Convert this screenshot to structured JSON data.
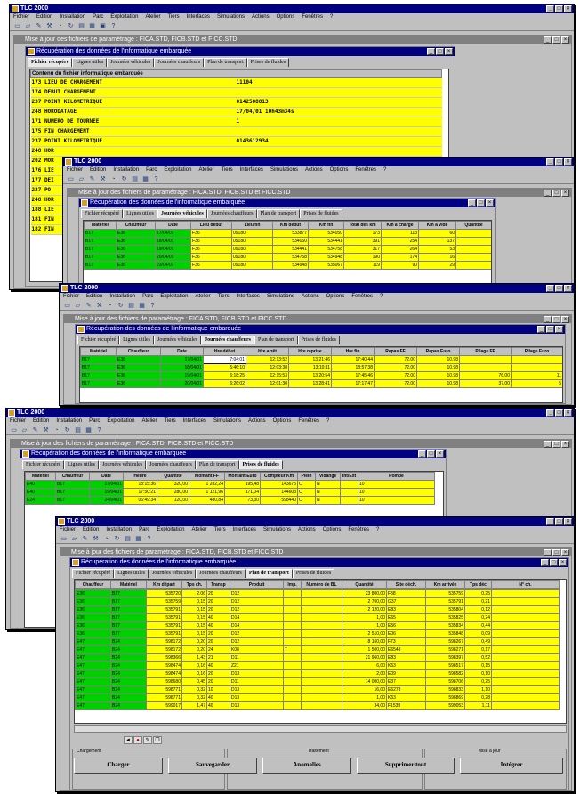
{
  "app": {
    "title": "TLC 2000",
    "menu": [
      "Fichier",
      "Edition",
      "Installation",
      "Parc",
      "Exploitation",
      "Atelier",
      "Tiers",
      "Interfaces",
      "Simulations",
      "Actions",
      "Options",
      "Fenêtres",
      "?"
    ],
    "tool_icons": [
      "new-icon",
      "open-icon",
      "edit-icon",
      "tools-icon",
      "chart-icon",
      "refresh-icon",
      "print-icon",
      "preview-icon",
      "calculator-icon",
      "window-icon",
      "help-icon"
    ],
    "window_buttons": [
      "_",
      "□",
      "×"
    ]
  },
  "sub_title_1": "Mise à jour des fichiers de paramétrage : FICA.STD, FICB.STD et FICC.STD",
  "sub_title_2": "Mise à jour des fichiers de paramétrage : FICA.STD, FICB.STD et FICC.STD",
  "inner_title": "Récupération des données de l'informatique embarquée",
  "tabs": [
    "Fichier récupéré",
    "Lignes utiles",
    "Journées véhicules",
    "Journées chauffeurs",
    "Plan de transport",
    "Prises de fluides"
  ],
  "win1": {
    "grid_header": "Contenu du fichier informatique embarquée",
    "lines": [
      [
        "173 LIEU DE CHARGEMENT",
        "11104"
      ],
      [
        "174 DEBUT CHARGEMENT",
        ""
      ],
      [
        "237 POINT KILOMETRIQUE",
        "0142588813"
      ],
      [
        "248 HORODATAGE",
        "17/04/01     10h43m34s"
      ],
      [
        "171 NUMERO DE TOURNEE",
        "1"
      ],
      [
        "175 FIN CHARGEMENT",
        ""
      ],
      [
        "237 POINT KILOMETRIQUE",
        "0143612934"
      ],
      [
        "248 HOR",
        ""
      ],
      [
        "202 MOR",
        ""
      ],
      [
        "176 LIE",
        ""
      ],
      [
        "177 DEI",
        ""
      ],
      [
        "237 PO",
        ""
      ],
      [
        "248 HOR",
        ""
      ],
      [
        "188 LIE",
        ""
      ],
      [
        "181 FIN",
        ""
      ],
      [
        "182 FIN",
        ""
      ]
    ],
    "footer_label": "Chargement"
  },
  "win2": {
    "headers": [
      "Matériel",
      "Chauffeur",
      "Date",
      "Lieu début",
      "Lieu fin",
      "Km début",
      "Km fin",
      "Total des km",
      "Km à charge",
      "Km à vide",
      "Quantité"
    ],
    "rows": [
      [
        "B17",
        "E36",
        "17/04/01",
        "F36",
        "09180",
        "533877",
        "534050",
        "173",
        "113",
        "60",
        ""
      ],
      [
        "B17",
        "E36",
        "18/04/01",
        "F36",
        "09180",
        "534050",
        "534441",
        "391",
        "254",
        "137",
        ""
      ],
      [
        "B17",
        "E36",
        "19/04/01",
        "F36",
        "09180",
        "534441",
        "534758",
        "317",
        "264",
        "53",
        ""
      ],
      [
        "B17",
        "E36",
        "20/04/01",
        "F36",
        "09180",
        "534758",
        "534948",
        "190",
        "174",
        "16",
        ""
      ],
      [
        "B17",
        "E36",
        "23/04/01",
        "F36",
        "09180",
        "534948",
        "535067",
        "119",
        "90",
        "29",
        ""
      ]
    ]
  },
  "win3": {
    "headers": [
      "Matériel",
      "Chauffeur",
      "Date",
      "Hre début",
      "Hre arrêt",
      "Hre reprise",
      "Hre fin",
      "Repas FF",
      "Repas Euro",
      "Pilage FF",
      "Pilage Euro"
    ],
    "rows": [
      [
        "B17",
        "E36",
        "17/04/01",
        "7:04:01",
        "12:13:52",
        "13:21:46",
        "17:40:44",
        "72,00",
        "10,98",
        "",
        ""
      ],
      [
        "B17",
        "E36",
        "18/04/01",
        "5:46:10",
        "12:03:38",
        "13:10:11",
        "18:57:38",
        "72,00",
        "10,98",
        "",
        ""
      ],
      [
        "B17",
        "E36",
        "19/04/01",
        "6:18:25",
        "12:15:53",
        "13:20:54",
        "17:45:46",
        "72,00",
        "10,98",
        "76,00",
        "11"
      ],
      [
        "B17",
        "E36",
        "20/04/01",
        "6:26:02",
        "12:01:30",
        "13:28:41",
        "17:17:47",
        "72,00",
        "10,98",
        "37,00",
        "5"
      ]
    ]
  },
  "win4": {
    "headers": [
      "Matériel",
      "Chauffeur",
      "Date",
      "Heure",
      "Quantité",
      "Montant FF",
      "Montant Euro",
      "Compteur Km",
      "Plein",
      "Vidange",
      "Int/Ext",
      "Pompe"
    ],
    "rows": [
      [
        "E40",
        "B17",
        "17/04/01",
        "18:15:36",
        "320,00",
        "1 282,24",
        "195,48",
        "143675",
        "O",
        "N",
        "I",
        "10"
      ],
      [
        "E40",
        "B17",
        "19/04/01",
        "17:50:21",
        "280,00",
        "1 121,96",
        "171,04",
        "144603",
        "O",
        "N",
        "I",
        "10"
      ],
      [
        "E24",
        "B17",
        "24/04/01",
        "06:49:34",
        "120,00",
        "480,84",
        "73,30",
        "598440",
        "O",
        "N",
        "I",
        "10"
      ]
    ]
  },
  "win5": {
    "headers": [
      "Chauffeur",
      "Matériel",
      "Km départ",
      "Tps ch.",
      "Transp",
      "Produit",
      "Imp.",
      "Numéro de BL",
      "Quantité",
      "Site déch.",
      "Km arrivée",
      "Tps déc",
      "N° ch."
    ],
    "rows": [
      [
        "E36",
        "B17",
        "535720",
        "2,06",
        "20",
        "D12",
        "",
        "",
        "23 800,00",
        "F38",
        "535759",
        "0,25",
        ""
      ],
      [
        "E36",
        "B17",
        "535759",
        "0,15",
        "20",
        "D12",
        "",
        "",
        "2 700,00",
        "G37",
        "535791",
        "0,21",
        ""
      ],
      [
        "E36",
        "B17",
        "535791",
        "0,15",
        "20",
        "D12",
        "",
        "",
        "2 120,00",
        "E83",
        "535804",
        "0,12",
        ""
      ],
      [
        "E36",
        "B17",
        "535791",
        "0,15",
        "40",
        "D14",
        "",
        "",
        "1,00",
        "E65",
        "535825",
        "0,24",
        ""
      ],
      [
        "E36",
        "B17",
        "535791",
        "0,15",
        "40",
        "D14",
        "",
        "",
        "1,00",
        "E56",
        "535834",
        "0,44",
        ""
      ],
      [
        "E36",
        "B17",
        "535791",
        "0,15",
        "20",
        "D12",
        "",
        "",
        "2 510,00",
        "E06",
        "535848",
        "0,09",
        ""
      ],
      [
        "E47",
        "B24",
        "598172",
        "0,20",
        "20",
        "D12",
        "",
        "",
        "8 160,00",
        "F73",
        "598267",
        "0,49",
        ""
      ],
      [
        "E47",
        "B24",
        "598172",
        "0,20",
        "24",
        "K08",
        "T",
        "",
        "1 500,00",
        "E6548",
        "598271",
        "0,17",
        ""
      ],
      [
        "E47",
        "B24",
        "598366",
        "1,43",
        "21",
        "D11",
        "",
        "",
        "21 960,00",
        "E83",
        "598397",
        "0,52",
        ""
      ],
      [
        "E47",
        "B24",
        "598474",
        "0,16",
        "40",
        "Z21",
        "",
        "",
        "6,00",
        "K53",
        "598517",
        "0,15",
        ""
      ],
      [
        "E47",
        "B24",
        "598474",
        "0,16",
        "20",
        "D13",
        "",
        "",
        "2,00",
        "E09",
        "598582",
        "0,10",
        ""
      ],
      [
        "E47",
        "B24",
        "598680",
        "0,45",
        "20",
        "D11",
        "",
        "",
        "14 000,00",
        "E37",
        "598706",
        "0,25",
        ""
      ],
      [
        "E47",
        "B24",
        "598771",
        "0,32",
        "10",
        "D13",
        "",
        "",
        "16,00",
        "E6278",
        "598833",
        "1,10",
        ""
      ],
      [
        "E47",
        "B24",
        "598771",
        "0,32",
        "40",
        "D13",
        "",
        "",
        "1,00",
        "K53",
        "598869",
        "0,28",
        ""
      ],
      [
        "E47",
        "B24",
        "599017",
        "1,47",
        "40",
        "D13",
        "",
        "",
        "34,00",
        "F1539",
        "599053",
        "1,11",
        ""
      ]
    ],
    "groups": [
      "Chargement",
      "Traitement",
      "Mise à jour"
    ],
    "buttons": [
      "Charger",
      "Sauvegarder",
      "Anomalies",
      "Supprimer tout",
      "Intégrer"
    ]
  }
}
